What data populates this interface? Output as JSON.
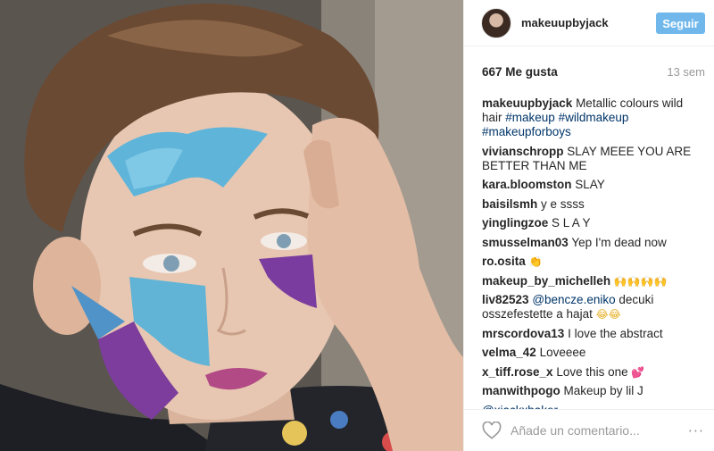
{
  "post": {
    "username": "makeuupbyjack",
    "follow_label": "Seguir",
    "likes": "667 Me gusta",
    "age": "13 sem",
    "comment_placeholder": "Añade un comentario...",
    "more_label": "···"
  },
  "icons": {
    "avatar": "profile-avatar",
    "like": "heart-outline-icon",
    "more": "more-options-icon"
  },
  "colors": {
    "follow_button": "#70b8ec",
    "hashtag": "#003569",
    "secondary_text": "#999999"
  },
  "comments": [
    {
      "author": "makeuupbyjack",
      "text": "Metallic colours wild hair",
      "tags": [
        "#makeup",
        "#wildmakeup",
        "#makeupforboys"
      ]
    },
    {
      "author": "vivianschropp",
      "text": "SLAY MEEE YOU ARE BETTER THAN ME"
    },
    {
      "author": "kara.bloomston",
      "text": "SLAY"
    },
    {
      "author": "baisilsmh",
      "text": "y e ssss"
    },
    {
      "author": "yinglingzoe",
      "text": "S L A Y"
    },
    {
      "author": "smusselman03",
      "text": "Yep I'm dead now"
    },
    {
      "author": "ro.osita",
      "text": "",
      "emoji": "👏"
    },
    {
      "author": "makeup_by_michelleh",
      "text": "",
      "emoji": "🙌🙌🙌🙌"
    },
    {
      "author": "liv82523",
      "mention": "@bencze.eniko",
      "text": "decuki osszefestette a hajat",
      "emoji": "😂😂"
    },
    {
      "author": "mrscordova13",
      "text": "I love the abstract"
    },
    {
      "author": "velma_42",
      "text": "Loveeee"
    },
    {
      "author": "x_tiff.rose_x",
      "text": "Love this one",
      "emoji": "💕"
    },
    {
      "author": "manwithpogo",
      "text": "Makeup by lil J"
    },
    {
      "author": "",
      "mention": "@xjackxbaker",
      "text": ""
    }
  ]
}
